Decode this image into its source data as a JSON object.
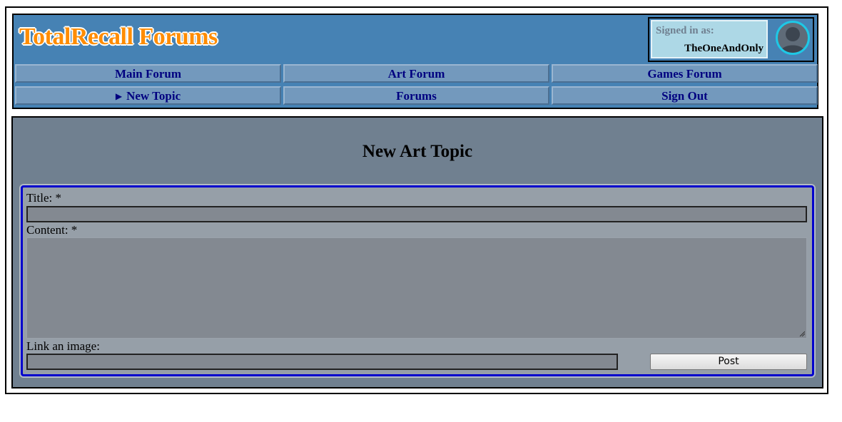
{
  "header": {
    "logo": "TotalRecall Forums",
    "user": {
      "signed_label": "Signed in as:",
      "username": "TheOneAndOnly"
    }
  },
  "nav": {
    "items": [
      {
        "label": "Main Forum"
      },
      {
        "label": "Art Forum"
      },
      {
        "label": "Games Forum"
      },
      {
        "label": "New Topic",
        "icon": "triangle-right-icon",
        "active": true
      },
      {
        "label": "Forums"
      },
      {
        "label": "Sign Out"
      }
    ]
  },
  "main": {
    "title": "New Art Topic",
    "form": {
      "title_label": "Title: *",
      "title_value": "",
      "content_label": "Content: *",
      "content_value": "",
      "image_label": "Link an image:",
      "image_value": "",
      "post_label": "Post"
    }
  },
  "colors": {
    "header_bg": "#4682b4",
    "logo": "#ff8c00",
    "nav_text": "#000080",
    "content_bg": "#708090",
    "form_border": "#0000cd"
  }
}
